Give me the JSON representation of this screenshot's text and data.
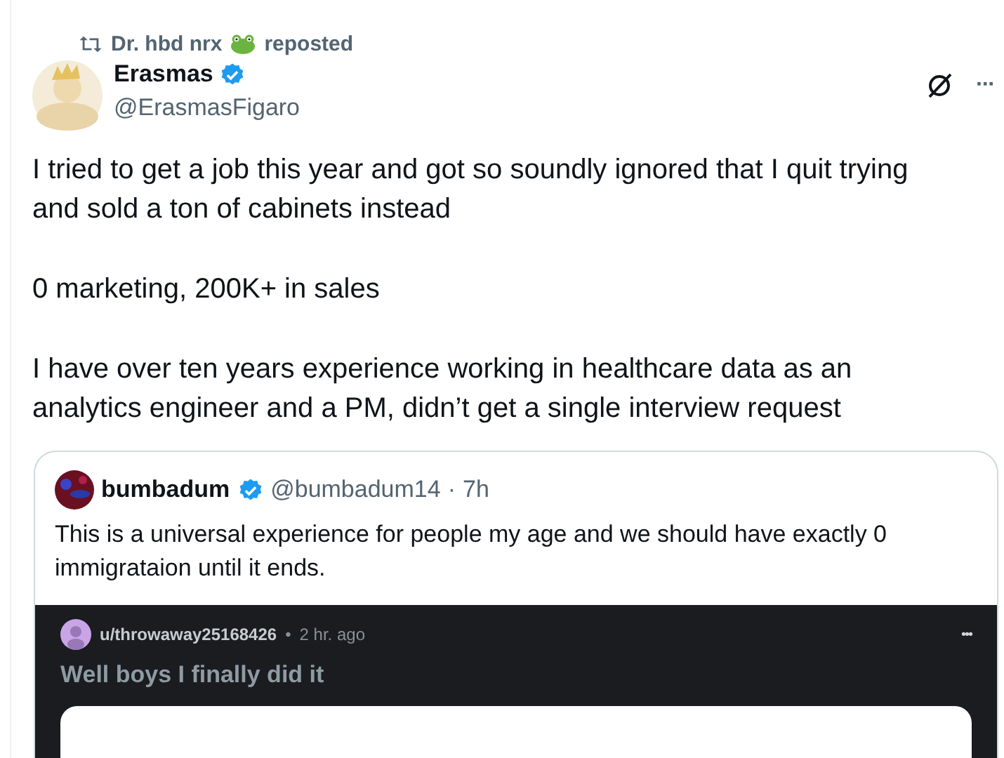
{
  "repost": {
    "user": "Dr. hbd nrx",
    "label": "reposted"
  },
  "author": {
    "name": "Erasmas",
    "verified": true,
    "handle": "@ErasmasFigaro"
  },
  "actions": {
    "more": "···"
  },
  "paragraphs": [
    "I tried to get a job this year and got so soundly ignored that I quit trying and sold a ton of cabinets instead",
    "0 marketing, 200K+ in sales",
    "I have over ten years experience working in healthcare data as an analytics engineer and a PM, didn’t get a single interview request"
  ],
  "quote": {
    "name": "bumbadum",
    "verified": true,
    "handle": "@bumbadum14",
    "separator": "·",
    "time": "7h",
    "text": "This is a universal experience for people my age and we should have exactly 0 immigrataion until it ends.",
    "embed": {
      "user": "u/throwaway25168426",
      "separator": "•",
      "time": "2 hr. ago",
      "more": "•••",
      "title": "Well boys I finally did it"
    }
  }
}
